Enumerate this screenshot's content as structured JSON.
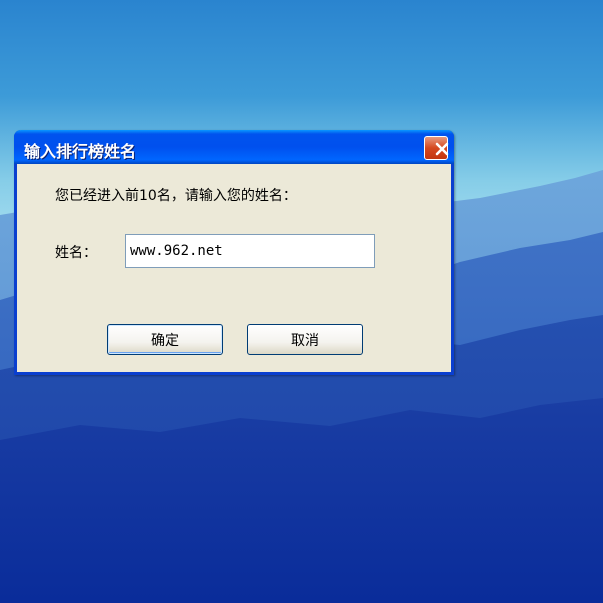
{
  "dialog": {
    "title": "输入排行榜姓名",
    "prompt": "您已经进入前10名，请输入您的姓名：",
    "name_label": "姓名：",
    "name_value": "www.962.net",
    "ok_label": "确定",
    "cancel_label": "取消"
  },
  "colors": {
    "titlebar": "#0053ee",
    "dialog_body": "#ece9d8",
    "close_button": "#d5481f",
    "sky_top": "#2a84cf",
    "sky_horizon": "#a7def0",
    "mountains_deep": "#0a2c9a"
  },
  "icons": {
    "close": "close-icon"
  }
}
